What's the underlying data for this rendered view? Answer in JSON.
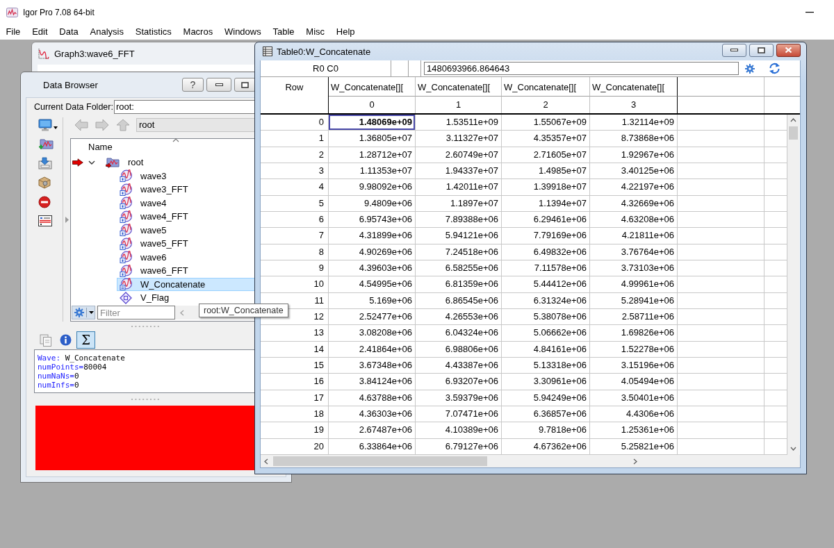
{
  "app": {
    "title": "Igor Pro 7.08 64-bit"
  },
  "menu": [
    "File",
    "Edit",
    "Data",
    "Analysis",
    "Statistics",
    "Macros",
    "Windows",
    "Table",
    "Misc",
    "Help"
  ],
  "graph_window": {
    "title": "Graph3:wave6_FFT"
  },
  "data_browser": {
    "title": "Data Browser",
    "help_label": "?",
    "current_folder_label": "Current Data Folder:",
    "current_folder": "root:",
    "nav_buttons": [
      {
        "kind": "back",
        "disabled": true
      },
      {
        "kind": "forward",
        "disabled": true
      },
      {
        "kind": "up",
        "disabled": true
      }
    ],
    "path": "root",
    "tree_header": "Name",
    "tree": [
      {
        "name": "root",
        "kind": "folder",
        "current": true,
        "expanded": true,
        "selected": false,
        "children": [
          {
            "name": "wave3",
            "kind": "wave",
            "selected": false
          },
          {
            "name": "wave3_FFT",
            "kind": "wave",
            "selected": false
          },
          {
            "name": "wave4",
            "kind": "wave",
            "selected": false
          },
          {
            "name": "wave4_FFT",
            "kind": "wave",
            "selected": false
          },
          {
            "name": "wave5",
            "kind": "wave",
            "selected": false
          },
          {
            "name": "wave5_FFT",
            "kind": "wave",
            "selected": false
          },
          {
            "name": "wave6",
            "kind": "wave",
            "selected": false
          },
          {
            "name": "wave6_FFT",
            "kind": "wave",
            "selected": false
          },
          {
            "name": "W_Concatenate",
            "kind": "matrix",
            "selected": true
          },
          {
            "name": "V_Flag",
            "kind": "variable",
            "selected": false
          }
        ]
      }
    ],
    "filter": {
      "placeholder": "Filter"
    },
    "info_tabs": [
      {
        "kind": "copy",
        "selected": false
      },
      {
        "kind": "info",
        "selected": false
      },
      {
        "kind": "stats",
        "label": "Σ",
        "selected": true
      }
    ],
    "info_lines": [
      {
        "key": "Wave: ",
        "value": "W_Concatenate"
      },
      {
        "key": "numPoints=",
        "value": "80004"
      },
      {
        "key": "numNaNs=",
        "value": "0"
      },
      {
        "key": "numInfs=",
        "value": "0"
      }
    ]
  },
  "tooltip": "root:W_Concatenate",
  "table_window": {
    "title": "Table0:W_Concatenate",
    "cell_ref": "R0 C0",
    "entry_value": "1480693966.864643",
    "row_header": "Row",
    "columns": [
      {
        "name": "W_Concatenate[][",
        "index": "0"
      },
      {
        "name": "W_Concatenate[][",
        "index": "1"
      },
      {
        "name": "W_Concatenate[][",
        "index": "2"
      },
      {
        "name": "W_Concatenate[][",
        "index": "3"
      }
    ],
    "rows": [
      {
        "label": "0",
        "cells": [
          {
            "value": "1.48069e+09",
            "selected": true
          },
          {
            "value": "1.53511e+09",
            "selected": false
          },
          {
            "value": "1.55067e+09",
            "selected": false
          },
          {
            "value": "1.32114e+09",
            "selected": false
          }
        ]
      },
      {
        "label": "1",
        "cells": [
          {
            "value": "1.36805e+07",
            "selected": false
          },
          {
            "value": "3.11327e+07",
            "selected": false
          },
          {
            "value": "4.35357e+07",
            "selected": false
          },
          {
            "value": "8.73868e+06",
            "selected": false
          }
        ]
      },
      {
        "label": "2",
        "cells": [
          {
            "value": "1.28712e+07",
            "selected": false
          },
          {
            "value": "2.60749e+07",
            "selected": false
          },
          {
            "value": "2.71605e+07",
            "selected": false
          },
          {
            "value": "1.92967e+06",
            "selected": false
          }
        ]
      },
      {
        "label": "3",
        "cells": [
          {
            "value": "1.11353e+07",
            "selected": false
          },
          {
            "value": "1.94337e+07",
            "selected": false
          },
          {
            "value": "1.4985e+07",
            "selected": false
          },
          {
            "value": "3.40125e+06",
            "selected": false
          }
        ]
      },
      {
        "label": "4",
        "cells": [
          {
            "value": "9.98092e+06",
            "selected": false
          },
          {
            "value": "1.42011e+07",
            "selected": false
          },
          {
            "value": "1.39918e+07",
            "selected": false
          },
          {
            "value": "4.22197e+06",
            "selected": false
          }
        ]
      },
      {
        "label": "5",
        "cells": [
          {
            "value": "9.4809e+06",
            "selected": false
          },
          {
            "value": "1.1897e+07",
            "selected": false
          },
          {
            "value": "1.1394e+07",
            "selected": false
          },
          {
            "value": "4.32669e+06",
            "selected": false
          }
        ]
      },
      {
        "label": "6",
        "cells": [
          {
            "value": "6.95743e+06",
            "selected": false
          },
          {
            "value": "7.89388e+06",
            "selected": false
          },
          {
            "value": "6.29461e+06",
            "selected": false
          },
          {
            "value": "4.63208e+06",
            "selected": false
          }
        ]
      },
      {
        "label": "7",
        "cells": [
          {
            "value": "4.31899e+06",
            "selected": false
          },
          {
            "value": "5.94121e+06",
            "selected": false
          },
          {
            "value": "7.79169e+06",
            "selected": false
          },
          {
            "value": "4.21811e+06",
            "selected": false
          }
        ]
      },
      {
        "label": "8",
        "cells": [
          {
            "value": "4.90269e+06",
            "selected": false
          },
          {
            "value": "7.24518e+06",
            "selected": false
          },
          {
            "value": "6.49832e+06",
            "selected": false
          },
          {
            "value": "3.76764e+06",
            "selected": false
          }
        ]
      },
      {
        "label": "9",
        "cells": [
          {
            "value": "4.39603e+06",
            "selected": false
          },
          {
            "value": "6.58255e+06",
            "selected": false
          },
          {
            "value": "7.11578e+06",
            "selected": false
          },
          {
            "value": "3.73103e+06",
            "selected": false
          }
        ]
      },
      {
        "label": "10",
        "cells": [
          {
            "value": "4.54995e+06",
            "selected": false
          },
          {
            "value": "6.81359e+06",
            "selected": false
          },
          {
            "value": "5.44412e+06",
            "selected": false
          },
          {
            "value": "4.99961e+06",
            "selected": false
          }
        ]
      },
      {
        "label": "11",
        "cells": [
          {
            "value": "5.169e+06",
            "selected": false
          },
          {
            "value": "6.86545e+06",
            "selected": false
          },
          {
            "value": "6.31324e+06",
            "selected": false
          },
          {
            "value": "5.28941e+06",
            "selected": false
          }
        ]
      },
      {
        "label": "12",
        "cells": [
          {
            "value": "2.52477e+06",
            "selected": false
          },
          {
            "value": "4.26553e+06",
            "selected": false
          },
          {
            "value": "5.38078e+06",
            "selected": false
          },
          {
            "value": "2.58711e+06",
            "selected": false
          }
        ]
      },
      {
        "label": "13",
        "cells": [
          {
            "value": "3.08208e+06",
            "selected": false
          },
          {
            "value": "6.04324e+06",
            "selected": false
          },
          {
            "value": "5.06662e+06",
            "selected": false
          },
          {
            "value": "1.69826e+06",
            "selected": false
          }
        ]
      },
      {
        "label": "14",
        "cells": [
          {
            "value": "2.41864e+06",
            "selected": false
          },
          {
            "value": "6.98806e+06",
            "selected": false
          },
          {
            "value": "4.84161e+06",
            "selected": false
          },
          {
            "value": "1.52278e+06",
            "selected": false
          }
        ]
      },
      {
        "label": "15",
        "cells": [
          {
            "value": "3.67348e+06",
            "selected": false
          },
          {
            "value": "4.43387e+06",
            "selected": false
          },
          {
            "value": "5.13318e+06",
            "selected": false
          },
          {
            "value": "3.15196e+06",
            "selected": false
          }
        ]
      },
      {
        "label": "16",
        "cells": [
          {
            "value": "3.84124e+06",
            "selected": false
          },
          {
            "value": "6.93207e+06",
            "selected": false
          },
          {
            "value": "3.30961e+06",
            "selected": false
          },
          {
            "value": "4.05494e+06",
            "selected": false
          }
        ]
      },
      {
        "label": "17",
        "cells": [
          {
            "value": "4.63788e+06",
            "selected": false
          },
          {
            "value": "3.59379e+06",
            "selected": false
          },
          {
            "value": "5.94249e+06",
            "selected": false
          },
          {
            "value": "3.50401e+06",
            "selected": false
          }
        ]
      },
      {
        "label": "18",
        "cells": [
          {
            "value": "4.36303e+06",
            "selected": false
          },
          {
            "value": "7.07471e+06",
            "selected": false
          },
          {
            "value": "6.36857e+06",
            "selected": false
          },
          {
            "value": "4.4306e+06",
            "selected": false
          }
        ]
      },
      {
        "label": "19",
        "cells": [
          {
            "value": "2.67487e+06",
            "selected": false
          },
          {
            "value": "4.10389e+06",
            "selected": false
          },
          {
            "value": "9.7818e+06",
            "selected": false
          },
          {
            "value": "1.25361e+06",
            "selected": false
          }
        ]
      },
      {
        "label": "20",
        "cells": [
          {
            "value": "6.33864e+06",
            "selected": false
          },
          {
            "value": "6.79127e+06",
            "selected": false
          },
          {
            "value": "4.67362e+06",
            "selected": false
          },
          {
            "value": "5.25821e+06",
            "selected": false
          }
        ]
      }
    ]
  }
}
